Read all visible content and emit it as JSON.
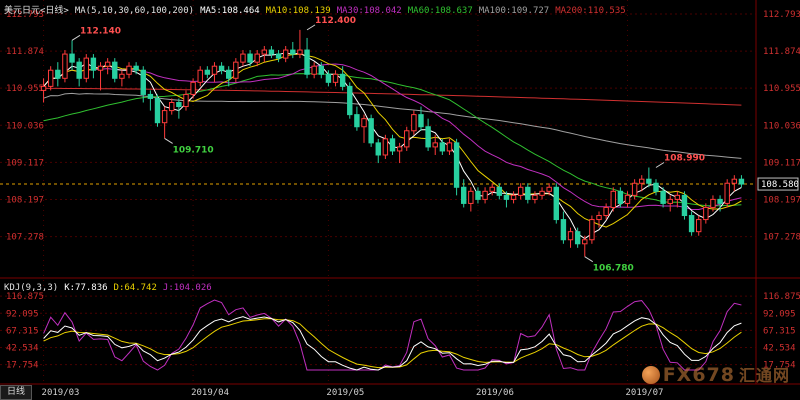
{
  "header": {
    "title": "美元日元<日线>",
    "ma_param": "MA(5,10,30,60,100,200)",
    "ma_values": [
      {
        "label": "MA5:",
        "value": "108.464",
        "color": "#ffffff"
      },
      {
        "label": "MA10:",
        "value": "108.139",
        "color": "#e8d000"
      },
      {
        "label": "MA30:",
        "value": "108.042",
        "color": "#c030c0"
      },
      {
        "label": "MA60:",
        "value": "108.637",
        "color": "#30c030"
      },
      {
        "label": "MA100:",
        "value": "109.727",
        "color": "#a0a0a0"
      },
      {
        "label": "MA200:",
        "value": "110.535",
        "color": "#d03030"
      }
    ]
  },
  "kdj_header": {
    "param": "KDJ(9,3,3)",
    "values": [
      {
        "label": "K:",
        "value": "77.836",
        "color": "#ffffff"
      },
      {
        "label": "D:",
        "value": "64.742",
        "color": "#e8d000"
      },
      {
        "label": "J:",
        "value": "104.026",
        "color": "#c030c0"
      }
    ]
  },
  "price_axis_labels": [
    "112.793",
    "111.874",
    "110.955",
    "110.036",
    "109.117",
    "108.197",
    "107.278"
  ],
  "current_price_label": "108.580",
  "kdj_axis_labels": [
    "116.875",
    "92.095",
    "67.315",
    "42.534",
    "17.754"
  ],
  "date_labels": [
    {
      "text": "2019/03",
      "x": 0
    },
    {
      "text": "2019/04",
      "x": 21
    },
    {
      "text": "2019/05",
      "x": 40
    },
    {
      "text": "2019/06",
      "x": 61
    },
    {
      "text": "2019/07",
      "x": 82
    }
  ],
  "annotations": [
    {
      "text": "112.140",
      "x": 4,
      "y": 112.14,
      "pos": "above",
      "color": "#ff5050"
    },
    {
      "text": "109.710",
      "x": 17,
      "y": 109.71,
      "pos": "below",
      "color": "#40d040"
    },
    {
      "text": "112.400",
      "x": 37,
      "y": 112.4,
      "pos": "above",
      "color": "#ff5050"
    },
    {
      "text": "106.780",
      "x": 76,
      "y": 106.78,
      "pos": "below",
      "color": "#40d040"
    },
    {
      "text": "108.990",
      "x": 86,
      "y": 108.99,
      "pos": "above",
      "color": "#ff5050"
    }
  ],
  "tab_label": "日线",
  "watermark": {
    "brand": "FX678",
    "cn": "汇通网"
  },
  "colors": {
    "up": "#ff3b3b",
    "down": "#28d0a0",
    "grid": "#4a0000"
  },
  "chart_data": {
    "type": "candlestick",
    "title": "美元日元<日线>",
    "ylim": [
      106.5,
      112.793
    ],
    "candles": [
      [
        110.9,
        111.2,
        110.6,
        111.0
      ],
      [
        111.0,
        111.5,
        110.9,
        111.4
      ],
      [
        111.4,
        111.6,
        111.0,
        111.2
      ],
      [
        111.2,
        111.9,
        111.1,
        111.8
      ],
      [
        111.8,
        112.14,
        111.4,
        111.6
      ],
      [
        111.6,
        111.7,
        111.0,
        111.2
      ],
      [
        111.2,
        111.8,
        111.1,
        111.7
      ],
      [
        111.7,
        111.8,
        111.2,
        111.4
      ],
      [
        111.4,
        111.6,
        110.9,
        111.5
      ],
      [
        111.5,
        111.7,
        111.3,
        111.6
      ],
      [
        111.6,
        111.7,
        111.1,
        111.2
      ],
      [
        111.2,
        111.4,
        111.0,
        111.3
      ],
      [
        111.3,
        111.6,
        111.2,
        111.5
      ],
      [
        111.5,
        111.6,
        111.3,
        111.4
      ],
      [
        111.4,
        111.5,
        110.6,
        110.8
      ],
      [
        110.8,
        110.9,
        110.4,
        110.7
      ],
      [
        110.7,
        110.8,
        110.0,
        110.1
      ],
      [
        110.1,
        110.5,
        109.71,
        110.4
      ],
      [
        110.4,
        110.7,
        110.3,
        110.6
      ],
      [
        110.6,
        110.7,
        110.2,
        110.5
      ],
      [
        110.5,
        110.9,
        110.4,
        110.8
      ],
      [
        110.8,
        111.2,
        110.7,
        111.1
      ],
      [
        111.1,
        111.5,
        111.0,
        111.4
      ],
      [
        111.4,
        111.5,
        111.2,
        111.3
      ],
      [
        111.3,
        111.6,
        111.1,
        111.5
      ],
      [
        111.5,
        111.6,
        111.3,
        111.4
      ],
      [
        111.4,
        111.5,
        111.0,
        111.2
      ],
      [
        111.2,
        111.7,
        111.1,
        111.6
      ],
      [
        111.6,
        111.9,
        111.5,
        111.8
      ],
      [
        111.8,
        111.9,
        111.5,
        111.6
      ],
      [
        111.6,
        111.9,
        111.5,
        111.8
      ],
      [
        111.8,
        112.0,
        111.6,
        111.9
      ],
      [
        111.9,
        112.0,
        111.7,
        111.8
      ],
      [
        111.8,
        111.9,
        111.6,
        111.7
      ],
      [
        111.7,
        112.0,
        111.6,
        111.9
      ],
      [
        111.9,
        112.1,
        111.7,
        111.8
      ],
      [
        111.8,
        112.4,
        111.7,
        111.9
      ],
      [
        111.9,
        112.2,
        111.2,
        111.3
      ],
      [
        111.3,
        111.6,
        111.2,
        111.5
      ],
      [
        111.5,
        111.6,
        111.2,
        111.3
      ],
      [
        111.3,
        111.4,
        111.0,
        111.1
      ],
      [
        111.1,
        111.4,
        111.0,
        111.3
      ],
      [
        111.3,
        111.5,
        110.9,
        111.0
      ],
      [
        111.0,
        111.1,
        110.2,
        110.3
      ],
      [
        110.3,
        110.5,
        109.9,
        110.0
      ],
      [
        110.0,
        110.3,
        109.6,
        110.2
      ],
      [
        110.2,
        110.3,
        109.5,
        109.6
      ],
      [
        109.6,
        109.7,
        109.1,
        109.3
      ],
      [
        109.3,
        109.8,
        109.2,
        109.7
      ],
      [
        109.7,
        109.8,
        109.3,
        109.4
      ],
      [
        109.4,
        109.6,
        109.1,
        109.5
      ],
      [
        109.5,
        110.0,
        109.4,
        109.9
      ],
      [
        109.9,
        110.4,
        109.8,
        110.3
      ],
      [
        110.3,
        110.5,
        109.9,
        110.0
      ],
      [
        110.0,
        110.2,
        109.4,
        109.5
      ],
      [
        109.5,
        109.8,
        109.3,
        109.6
      ],
      [
        109.6,
        109.7,
        109.3,
        109.4
      ],
      [
        109.4,
        109.7,
        109.3,
        109.6
      ],
      [
        109.6,
        109.7,
        108.3,
        108.5
      ],
      [
        108.5,
        108.7,
        108.0,
        108.1
      ],
      [
        108.1,
        108.5,
        107.9,
        108.4
      ],
      [
        108.4,
        108.5,
        108.1,
        108.2
      ],
      [
        108.2,
        108.5,
        108.1,
        108.4
      ],
      [
        108.4,
        108.6,
        108.3,
        108.5
      ],
      [
        108.5,
        108.6,
        108.2,
        108.3
      ],
      [
        108.3,
        108.4,
        108.0,
        108.2
      ],
      [
        108.2,
        108.4,
        108.1,
        108.3
      ],
      [
        108.3,
        108.6,
        108.2,
        108.5
      ],
      [
        108.5,
        108.6,
        108.1,
        108.2
      ],
      [
        108.2,
        108.4,
        108.1,
        108.3
      ],
      [
        108.3,
        108.5,
        108.2,
        108.4
      ],
      [
        108.4,
        108.6,
        108.3,
        108.5
      ],
      [
        108.5,
        108.6,
        107.6,
        107.7
      ],
      [
        107.7,
        107.9,
        107.1,
        107.2
      ],
      [
        107.2,
        107.5,
        107.0,
        107.4
      ],
      [
        107.4,
        107.5,
        107.0,
        107.1
      ],
      [
        107.1,
        107.3,
        106.78,
        107.2
      ],
      [
        107.2,
        107.8,
        107.1,
        107.7
      ],
      [
        107.7,
        107.9,
        107.5,
        107.8
      ],
      [
        107.8,
        108.1,
        107.7,
        108.0
      ],
      [
        108.0,
        108.5,
        107.9,
        108.4
      ],
      [
        108.4,
        108.5,
        108.0,
        108.1
      ],
      [
        108.1,
        108.4,
        108.0,
        108.3
      ],
      [
        108.3,
        108.7,
        108.2,
        108.6
      ],
      [
        108.6,
        108.8,
        108.4,
        108.7
      ],
      [
        108.7,
        108.99,
        108.5,
        108.6
      ],
      [
        108.6,
        108.7,
        108.3,
        108.4
      ],
      [
        108.4,
        108.5,
        108.0,
        108.1
      ],
      [
        108.1,
        108.3,
        107.9,
        108.2
      ],
      [
        108.2,
        108.4,
        108.0,
        108.3
      ],
      [
        108.3,
        108.4,
        107.7,
        107.8
      ],
      [
        107.8,
        107.9,
        107.3,
        107.4
      ],
      [
        107.4,
        107.8,
        107.3,
        107.7
      ],
      [
        107.7,
        108.1,
        107.6,
        108.0
      ],
      [
        108.0,
        108.3,
        107.9,
        108.2
      ],
      [
        108.2,
        108.3,
        107.9,
        108.1
      ],
      [
        108.1,
        108.7,
        108.0,
        108.6
      ],
      [
        108.6,
        108.8,
        108.4,
        108.7
      ],
      [
        108.7,
        108.8,
        108.5,
        108.58
      ]
    ],
    "ma_last": {
      "MA5": 108.464,
      "MA10": 108.139,
      "MA30": 108.042,
      "MA60": 108.637,
      "MA100": 109.727,
      "MA200": 110.535
    },
    "ma200_start": 110.95,
    "ma100_start": 110.55,
    "ma60_start": 110.15,
    "ma30_start": 110.65,
    "kdj": {
      "ylim": [
        10,
        120
      ],
      "K_last": 77.836,
      "D_last": 64.742,
      "J_last": 104.026
    }
  }
}
